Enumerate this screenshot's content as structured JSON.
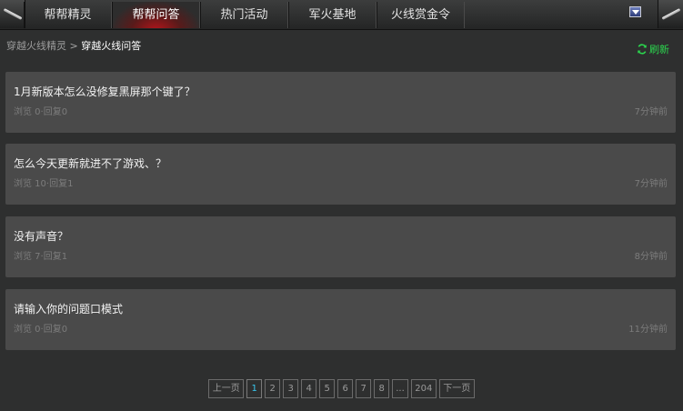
{
  "nav": {
    "tabs": [
      {
        "label": "帮帮精灵"
      },
      {
        "label": "帮帮问答",
        "active": true
      },
      {
        "label": "热门活动"
      },
      {
        "label": "军火基地"
      },
      {
        "label": "火线赏金令"
      }
    ],
    "dropdown_icon": "chevron-down-icon"
  },
  "breadcrumb": {
    "root": "穿越火线精灵",
    "separator": ">",
    "current": "穿越火线问答"
  },
  "refresh": {
    "label": "刷新",
    "icon": "refresh-icon",
    "color": "#2bd64e"
  },
  "questions": [
    {
      "title": "1月新版本怎么没修复黑屏那个键了？",
      "meta": "浏览 0·回复0",
      "time": "7分钟前"
    },
    {
      "title": "怎么今天更新就进不了游戏、？",
      "meta": "浏览 10·回复1",
      "time": "7分钟前"
    },
    {
      "title": "没有声音？",
      "meta": "浏览 7·回复1",
      "time": "8分钟前"
    },
    {
      "title": "请输入你的问题口模式",
      "meta": "浏览 0·回复0",
      "time": "11分钟前"
    }
  ],
  "pagination": {
    "prev": "上一页",
    "pages": [
      "1",
      "2",
      "3",
      "4",
      "5",
      "6",
      "7",
      "8",
      "...",
      "204"
    ],
    "current": "1",
    "next": "下一页"
  },
  "colors": {
    "background": "#2e2f2f",
    "card": "#4a4a4a",
    "active_tab": "#b3151b",
    "current_page": "#38c8f0"
  }
}
